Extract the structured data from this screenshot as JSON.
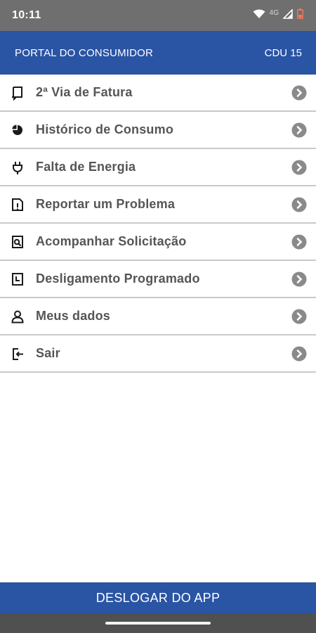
{
  "status_bar": {
    "time": "10:11",
    "network": "4G",
    "icons": [
      "wifi-icon",
      "signal-icon",
      "battery-icon"
    ]
  },
  "app_bar": {
    "title": "PORTAL DO CONSUMIDOR",
    "code": "CDU 15"
  },
  "menu": {
    "items": [
      {
        "label": "2ª Via de Fatura",
        "icon": "invoice-icon"
      },
      {
        "label": "Histórico de Consumo",
        "icon": "pie-chart-icon"
      },
      {
        "label": "Falta de Energia",
        "icon": "plug-icon"
      },
      {
        "label": "Reportar um Problema",
        "icon": "report-icon"
      },
      {
        "label": "Acompanhar Solicitação",
        "icon": "search-document-icon"
      },
      {
        "label": "Desligamento Programado",
        "icon": "clock-icon"
      },
      {
        "label": "Meus dados",
        "icon": "user-icon"
      },
      {
        "label": "Sair",
        "icon": "exit-icon"
      }
    ]
  },
  "footer": {
    "logout_label": "DESLOGAR DO APP"
  },
  "colors": {
    "primary": "#2a54a4",
    "status_bar": "#6f6f6f",
    "text": "#555555",
    "chevron": "#8a8a8a",
    "divider": "#c9c9c9"
  }
}
